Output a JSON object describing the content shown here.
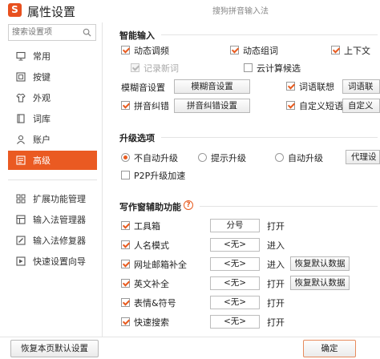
{
  "app": {
    "title": "属性设置",
    "logo_char": "S",
    "subtitle": "搜狗拼音输入法"
  },
  "sidebar": {
    "search_placeholder": "搜索设置项",
    "items": [
      {
        "label": "常用",
        "icon": "monitor-icon"
      },
      {
        "label": "按键",
        "icon": "keyboard-icon"
      },
      {
        "label": "外观",
        "icon": "shirt-icon"
      },
      {
        "label": "词库",
        "icon": "book-icon"
      },
      {
        "label": "账户",
        "icon": "user-icon"
      },
      {
        "label": "高级",
        "icon": "advanced-icon",
        "active": true
      }
    ],
    "tools": [
      {
        "label": "扩展功能管理",
        "icon": "extension-icon"
      },
      {
        "label": "输入法管理器",
        "icon": "manager-icon"
      },
      {
        "label": "输入法修复器",
        "icon": "repair-icon"
      },
      {
        "label": "快速设置向导",
        "icon": "wizard-icon"
      }
    ]
  },
  "smart_input": {
    "title": "智能输入",
    "items": {
      "dynamic_adjust": "动态调频",
      "dynamic_group": "动态组词",
      "up_down": "上下文",
      "record_new": "记录新词",
      "cloud_calc": "云计算候选"
    },
    "fuzzy_label": "模糊音设置",
    "fuzzy_button": "模糊音设置",
    "association_label": "词语联想",
    "association_button": "词语联",
    "pinyin_correct_label": "拼音纠错",
    "pinyin_correct_button": "拼音纠错设置",
    "custom_phrase_label": "自定义短语",
    "custom_phrase_button": "自定义"
  },
  "upgrade": {
    "title": "升级选项",
    "no_auto": "不自动升级",
    "prompt": "提示升级",
    "auto": "自动升级",
    "proxy_button": "代理设",
    "p2p": "P2P升级加速"
  },
  "writing_aid": {
    "title": "写作窗辅助功能",
    "help": "?",
    "rows": [
      {
        "label": "工具箱",
        "value": "分号",
        "action": "打开",
        "button": ""
      },
      {
        "label": "人名模式",
        "value": "<无>",
        "action": "进入",
        "button": ""
      },
      {
        "label": "网址邮箱补全",
        "value": "<无>",
        "action": "进入",
        "button": "恢复默认数据"
      },
      {
        "label": "英文补全",
        "value": "<无>",
        "action": "打开",
        "button": "恢复默认数据"
      },
      {
        "label": "表情&符号",
        "value": "<无>",
        "action": "打开",
        "button": ""
      },
      {
        "label": "快速搜索",
        "value": "<无>",
        "action": "打开",
        "button": ""
      }
    ]
  },
  "footer": {
    "restore_button": "恢复本页默认设置",
    "ok_button": "确定"
  },
  "colors": {
    "accent": "#ea5a22"
  }
}
